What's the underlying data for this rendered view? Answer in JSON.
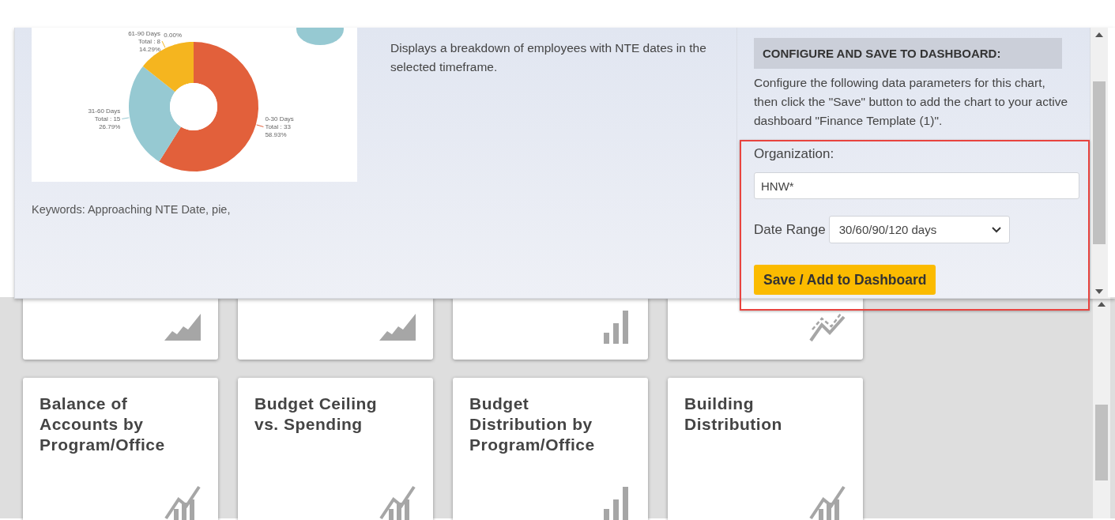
{
  "chart_preview": {
    "chart_data": {
      "type": "donut",
      "categories": [
        "0-30 Days",
        "31-60 Days",
        "61-90 Days"
      ],
      "values": [
        58.93,
        26.79,
        14.29
      ],
      "annotations": [
        {
          "text": "Total : 33"
        },
        {
          "text": "58.93%"
        },
        {
          "text": "Total : 15"
        },
        {
          "text": "26.79%"
        },
        {
          "text": "Total : 8"
        },
        {
          "text": "14.29%"
        },
        {
          "text": "0.00%"
        }
      ]
    }
  },
  "keywords": "Keywords: Approaching NTE Date, pie,",
  "description": "Displays a breakdown of employees with NTE dates in the selected timeframe.",
  "configure": {
    "heading": "CONFIGURE AND SAVE TO DASHBOARD:",
    "text": "Configure the following data parameters for this chart, then click the \"Save\" button to add the chart to your active dashboard \"Finance Template (1)\".",
    "organization_label": "Organization:",
    "organization_value": "HNW*",
    "date_range_label": "Date Range",
    "date_range_value": "30/60/90/120 days",
    "save_button": "Save / Add to Dashboard"
  },
  "tiles": [
    {
      "kind": "area"
    },
    {
      "kind": "area"
    },
    {
      "kind": "bar"
    },
    {
      "kind": "line"
    },
    {
      "title": "Balance of Accounts by Program/Office",
      "kind": "combo"
    },
    {
      "title": "Budget Ceiling vs. Spending",
      "kind": "combo"
    },
    {
      "title": "Budget Distribution by Program/Office",
      "kind": "bar"
    },
    {
      "title": "Building Distribution",
      "kind": "combo"
    }
  ]
}
